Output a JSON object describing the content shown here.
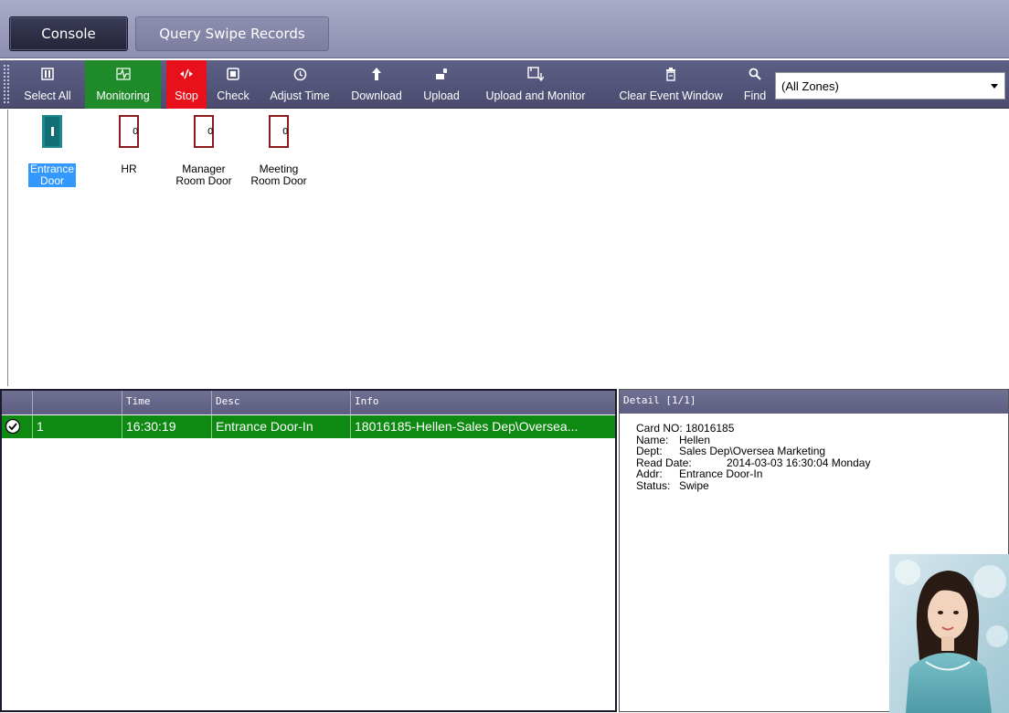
{
  "header": {
    "console_label": "Console",
    "query_label": "Query Swipe Records"
  },
  "toolbar": {
    "select_all": "Select All",
    "monitoring": "Monitoring",
    "stop": "Stop",
    "check": "Check",
    "adjust_time": "Adjust Time",
    "download": "Download",
    "upload": "Upload",
    "upload_monitor": "Upload and Monitor",
    "clear": "Clear Event Window",
    "find": "Find",
    "zone_value": "(All Zones)",
    "colors": {
      "monitoring": "#1f8a2a",
      "stop": "#e8101a"
    },
    "icons": [
      "select-all-icon",
      "monitoring-icon",
      "stop-icon",
      "check-icon",
      "clock-icon",
      "download-arrow-icon",
      "upload-icon",
      "upload-monitor-icon",
      "trash-icon",
      "search-icon"
    ]
  },
  "doors": [
    {
      "line1": "Entrance",
      "line2": "Door",
      "state": "open",
      "counter": ""
    },
    {
      "line1": "HR",
      "line2": "",
      "state": "closed",
      "counter": "0"
    },
    {
      "line1": "Manager",
      "line2": "Room Door",
      "state": "closed",
      "counter": "0"
    },
    {
      "line1": "Meeting",
      "line2": "Room Door",
      "state": "closed",
      "counter": "0"
    }
  ],
  "events": {
    "columns": [
      "",
      "Time",
      "Desc",
      "Info"
    ],
    "rows": [
      {
        "no": "1",
        "time": "16:30:19",
        "desc": "Entrance Door-In",
        "info": "18016185-Hellen-Sales Dep\\Oversea..."
      }
    ],
    "row_color": "#0e8a12"
  },
  "detail": {
    "title": "Detail  [1/1]",
    "card_line": "Card NO: 18016185",
    "name_key": "Name:",
    "name_val": "Hellen",
    "dept_key": "Dept:",
    "dept_val": "Sales Dep\\Oversea Marketing",
    "date_key": "Read Date:",
    "date_val": "2014-03-03 16:30:04 Monday",
    "addr_key": "Addr:",
    "addr_val": "Entrance Door-In",
    "status_key": "Status:",
    "status_val": "Swipe"
  }
}
